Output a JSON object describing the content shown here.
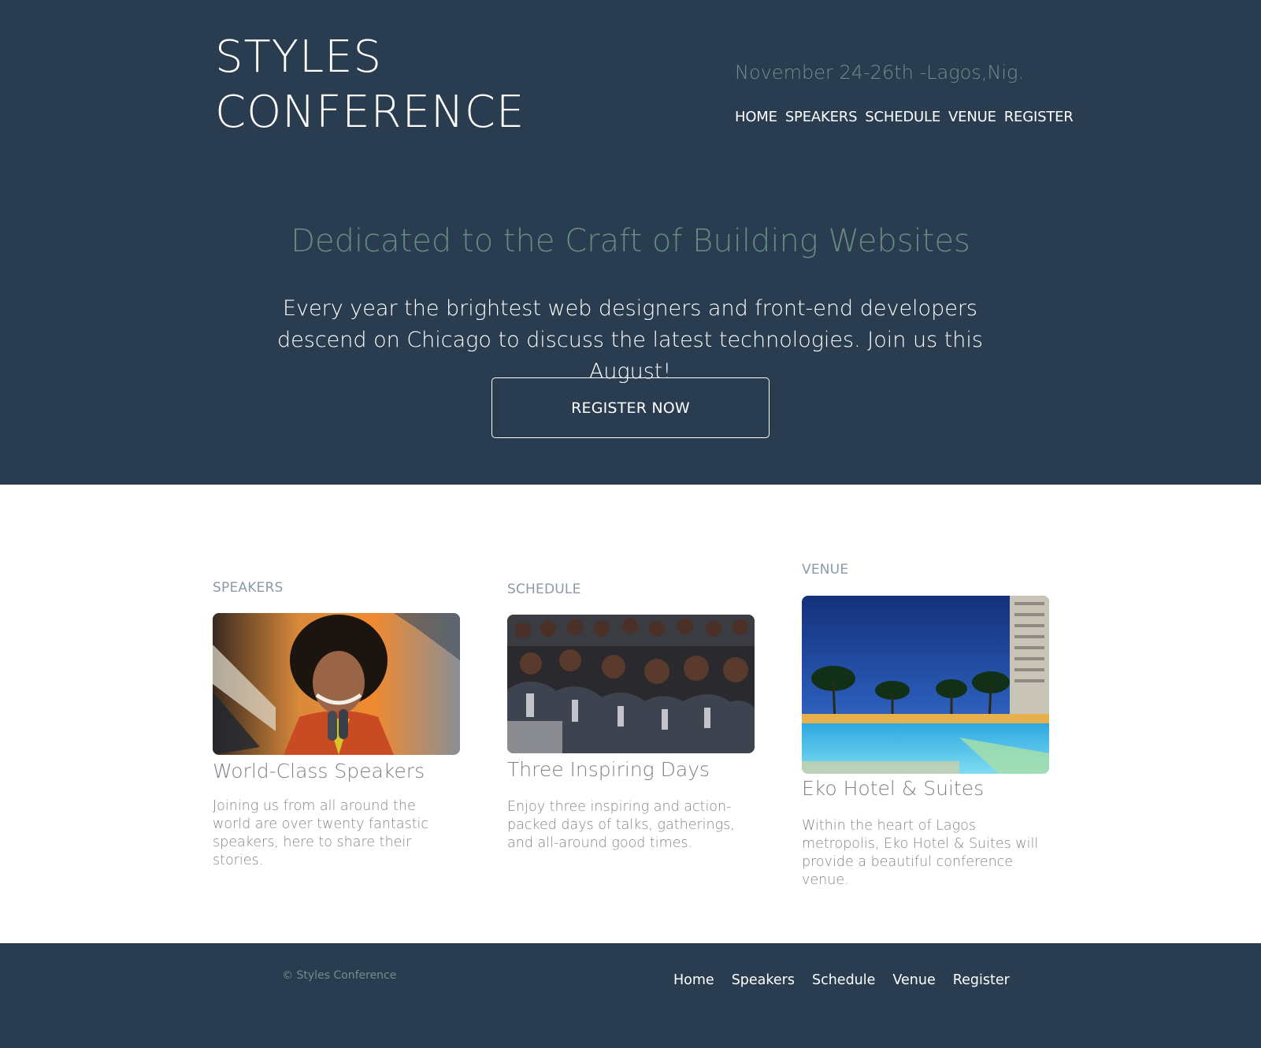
{
  "header": {
    "logo_line1": "STYLES",
    "logo_line2": "CONFERENCE",
    "date_location": "November 24-26th -Lagos,Nig.",
    "nav": [
      "HOME",
      "SPEAKERS",
      "SCHEDULE",
      "VENUE",
      "REGISTER"
    ]
  },
  "hero": {
    "title": "Dedicated to the Craft of Building Websites",
    "text": "Every year the brightest web designers and front-end developers descend on Chicago to discuss the latest technologies. Join us this August!",
    "cta_label": "REGISTER NOW"
  },
  "sections": [
    {
      "label": "SPEAKERS",
      "title": "World-Class Speakers",
      "text": "Joining us from all around the world are over twenty fantastic speakers, here to share their stories."
    },
    {
      "label": "SCHEDULE",
      "title": "Three Inspiring Days",
      "text": "Enjoy three inspiring and action-packed days of talks, gatherings, and all-around good times."
    },
    {
      "label": "VENUE",
      "title": "Eko Hotel & Suites",
      "text": "Within the heart of Lagos metropolis, Eko Hotel & Suites will provide a beautiful conference venue."
    }
  ],
  "footer": {
    "copyright": "© Styles Conference",
    "nav": [
      "Home",
      "Speakers",
      "Schedule",
      "Venue",
      "Register"
    ]
  },
  "colors": {
    "header_bg": "#2a3d50",
    "accent_teal": "#648a82",
    "muted_text": "#7f868b"
  }
}
